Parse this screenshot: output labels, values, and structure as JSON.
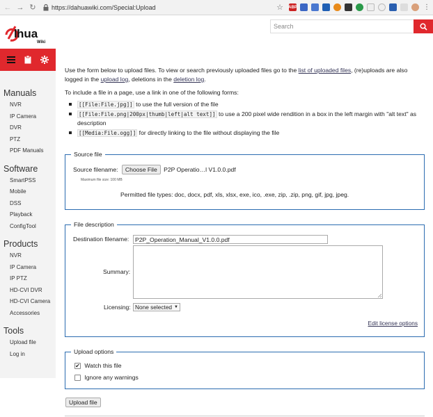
{
  "browser": {
    "url": "https://dahuawiki.com/Special:Upload",
    "colors": {
      "chrome_bg": "#f2f2f2"
    }
  },
  "site": {
    "logo_icon": "dahua-wiki-logo",
    "search": {
      "placeholder": "Search"
    },
    "colors": {
      "brand_red": "#e0282d",
      "fieldset_blue": "#2a6bb0"
    }
  },
  "sidebar": {
    "sections": [
      {
        "heading": "Manuals",
        "items": [
          "NVR",
          "IP Camera",
          "DVR",
          "PTZ",
          "PDF Manuals"
        ]
      },
      {
        "heading": "Software",
        "items": [
          "SmartPSS",
          "Mobile",
          "DSS",
          "Playback",
          "ConfigTool"
        ]
      },
      {
        "heading": "Products",
        "items": [
          "NVR",
          "IP Camera",
          "IP PTZ",
          "HD-CVI DVR",
          "HD-CVI Camera",
          "Accessories"
        ]
      },
      {
        "heading": "Tools",
        "items": [
          "Upload file",
          "Log in"
        ]
      }
    ]
  },
  "intro": {
    "p1_a": "Use the form below to upload files. To view or search previously uploaded files go to the ",
    "p1_link1": "list of uploaded files",
    "p1_b": ", (re)uploads are also logged in the ",
    "p1_link2": "upload log",
    "p1_c": ", deletions in the ",
    "p1_link3": "deletion log",
    "p1_d": ".",
    "p2": "To include a file in a page, use a link in one of the following forms:",
    "forms": [
      {
        "code": "[[File:File.jpg]]",
        "desc": " to use the full version of the file"
      },
      {
        "code": "[[File:File.png|200px|thumb|left|alt text]]",
        "desc": " to use a 200 pixel wide rendition in a box in the left margin with \"alt text\" as description"
      },
      {
        "code": "[[Media:File.ogg]]",
        "desc": " for directly linking to the file without displaying the file"
      }
    ]
  },
  "source_file": {
    "legend": "Source file",
    "filename_label": "Source filename:",
    "choose_button": "Choose File",
    "chosen_file": "P2P Operatio…l V1.0.0.pdf",
    "max_size": "Maximum file size: 100 MB",
    "permitted": "Permitted file types: doc, docx, pdf, xls, xlsx, exe, ico, .exe, zip, .zip, png, gif, jpg, jpeg."
  },
  "file_description": {
    "legend": "File description",
    "dest_label": "Destination filename:",
    "dest_value": "P2P_Operation_Manual_V1.0.0.pdf",
    "summary_label": "Summary:",
    "licensing_label": "Licensing:",
    "licensing_value": "None selected",
    "edit_license": "Edit license options"
  },
  "upload_options": {
    "legend": "Upload options",
    "watch_label": "Watch this file",
    "watch_checked": true,
    "ignore_label": "Ignore any warnings",
    "ignore_checked": false
  },
  "upload_button": "Upload file"
}
